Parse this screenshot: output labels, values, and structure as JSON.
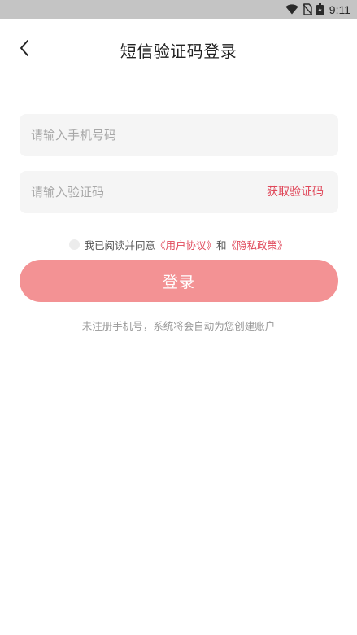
{
  "status_bar": {
    "time": "9:11",
    "icons": [
      "wifi-icon",
      "no-sim-icon",
      "battery-icon"
    ]
  },
  "header": {
    "back_icon": "chevron-left-icon",
    "title": "短信验证码登录"
  },
  "form": {
    "phone_placeholder": "请输入手机号码",
    "phone_value": "",
    "code_placeholder": "请输入验证码",
    "code_value": "",
    "get_code_label": "获取验证码"
  },
  "agreement": {
    "checked": false,
    "prefix": "我已阅读并同意",
    "user_agreement": "《用户协议》",
    "connector": "和",
    "privacy_policy": "《隐私政策》"
  },
  "login_button": {
    "label": "登录"
  },
  "hint": "未注册手机号，系统将会自动为您创建账户",
  "colors": {
    "accent": "#e0485a",
    "login_button": "#f39294",
    "input_bg": "#f5f5f5",
    "status_bar_bg": "#c4c4c4"
  }
}
